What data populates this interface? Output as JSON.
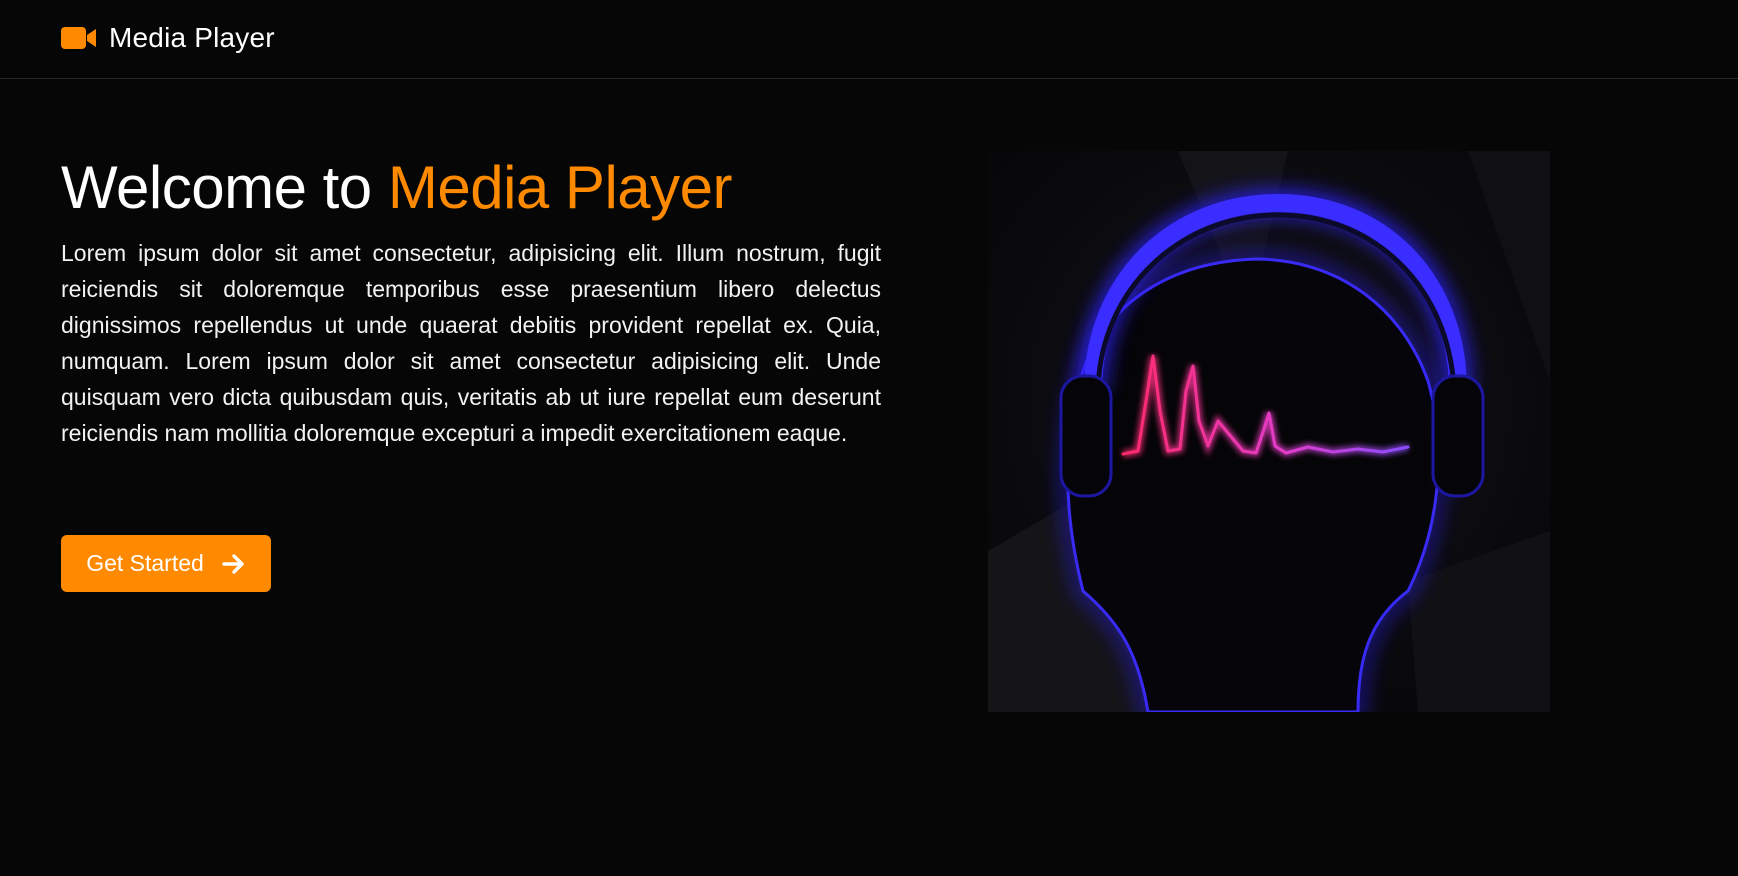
{
  "theme": {
    "accent": "#ff8a00",
    "background": "#060606"
  },
  "navbar": {
    "brand_icon": "video-camera-icon",
    "brand_name": "Media Player"
  },
  "hero": {
    "title_prefix": "Welcome to ",
    "title_accent": "Media Player",
    "description": "Lorem ipsum dolor sit amet consectetur, adipisicing elit. Illum nostrum, fugit reiciendis sit doloremque temporibus esse praesentium libero delectus dignissimos repellendus ut unde quaerat debitis provident repellat ex. Quia, numquam. Lorem ipsum dolor sit amet consectetur adipisicing elit. Unde quisquam vero dicta quibusdam quis, veritatis ab ut iure repellat eum deserunt reiciendis nam mollitia doloremque excepturi a impedit exercitationem eaque.",
    "cta_label": "Get Started",
    "cta_icon": "arrow-right-icon",
    "image": "headphones-heartbeat-illustration"
  }
}
